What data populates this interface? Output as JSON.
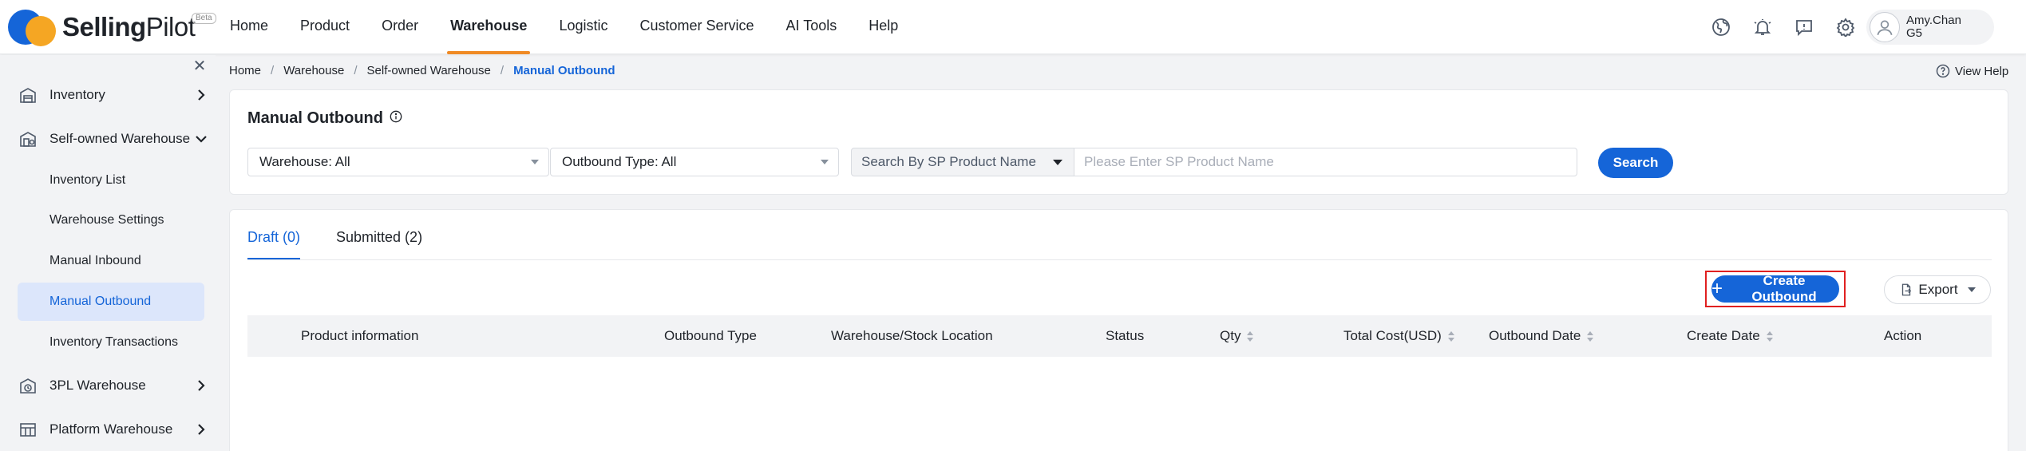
{
  "app": {
    "brand_bold": "Selling",
    "brand_light": "Pilot",
    "beta": "Beta",
    "accent": "#1565d8",
    "nav_accent": "#f08a24"
  },
  "nav": {
    "items": [
      {
        "label": "Home"
      },
      {
        "label": "Product"
      },
      {
        "label": "Order"
      },
      {
        "label": "Warehouse",
        "active": true
      },
      {
        "label": "Logistic"
      },
      {
        "label": "Customer Service"
      },
      {
        "label": "AI Tools"
      },
      {
        "label": "Help"
      }
    ],
    "icons": [
      "globe-icon",
      "bell-icon",
      "chat-icon",
      "gear-icon"
    ]
  },
  "user": {
    "name": "Amy.Chan",
    "level": "G5"
  },
  "sidebar": {
    "groups": [
      {
        "label": "Inventory",
        "icon": "warehouse-icon",
        "expanded": false
      },
      {
        "label": "Self-owned Warehouse",
        "icon": "self-warehouse-icon",
        "expanded": true,
        "items": [
          {
            "label": "Inventory List"
          },
          {
            "label": "Warehouse Settings"
          },
          {
            "label": "Manual Inbound"
          },
          {
            "label": "Manual Outbound",
            "active": true
          },
          {
            "label": "Inventory Transactions"
          }
        ]
      },
      {
        "label": "3PL Warehouse",
        "icon": "3pl-warehouse-icon",
        "expanded": false
      },
      {
        "label": "Platform Warehouse",
        "icon": "platform-warehouse-icon",
        "expanded": false
      }
    ]
  },
  "breadcrumb": [
    "Home",
    "Warehouse",
    "Self-owned Warehouse",
    "Manual Outbound"
  ],
  "view_help": "View Help",
  "page": {
    "title": "Manual Outbound",
    "filters": {
      "warehouse": "Warehouse: All",
      "outbound_type": "Outbound Type: All",
      "search_by": "Search By SP Product Name",
      "search_placeholder": "Please Enter SP Product Name",
      "search_button": "Search"
    },
    "tabs": [
      {
        "label": "Draft (0)",
        "active": true
      },
      {
        "label": "Submitted (2)"
      }
    ],
    "actions": {
      "create": "Create Outbound",
      "export": "Export"
    },
    "table": {
      "columns": [
        {
          "label": "Product information"
        },
        {
          "label": "Outbound Type"
        },
        {
          "label": "Warehouse/Stock Location"
        },
        {
          "label": "Status"
        },
        {
          "label": "Qty",
          "sortable": true
        },
        {
          "label": "Total Cost(USD)",
          "sortable": true
        },
        {
          "label": "Outbound Date",
          "sortable": true
        },
        {
          "label": "Create Date",
          "sortable": true
        },
        {
          "label": "Action"
        }
      ],
      "rows": []
    }
  }
}
